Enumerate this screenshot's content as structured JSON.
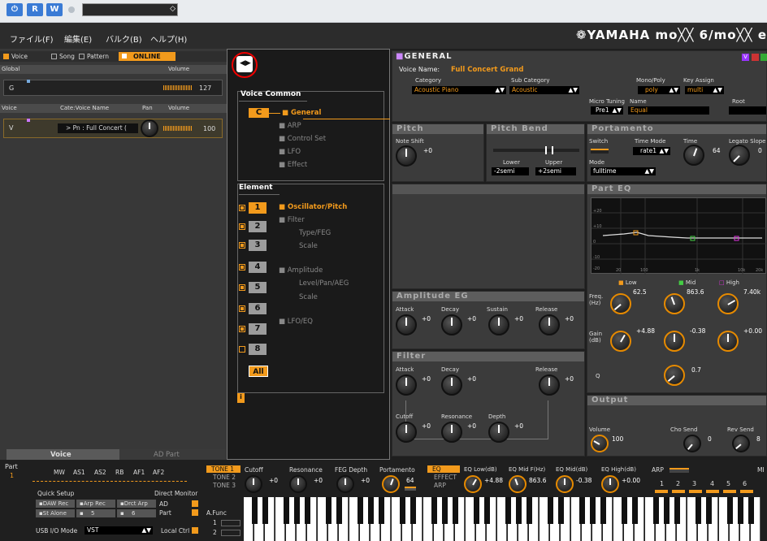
{
  "menubar": {
    "file": "ファイル(F)",
    "edit": "編集(E)",
    "bulk": "バルク(B)",
    "help": "ヘルプ(H)",
    "brand": "❁YAMAHA  mo╳╳ 6/mo╳╳ e"
  },
  "toolbar": {
    "r": "R",
    "w": "W"
  },
  "left": {
    "tabs": {
      "voice": "Voice",
      "song": "Song",
      "pattern": "Pattern",
      "online": "ONLINE"
    },
    "global_header": "Global",
    "volume_header": "Volume",
    "global_row": {
      "label": "G",
      "volume": "127"
    },
    "voice_headers": {
      "voice": "Voice",
      "cate": "Cate:Voice Name",
      "pan": "Pan",
      "volume": "Volume"
    },
    "voice_row": {
      "label": "V",
      "name": "> Pn : Full Concert (",
      "volume": "100"
    },
    "bottom_tabs": {
      "voice": "Voice",
      "ad": "AD Part"
    }
  },
  "nav": {
    "voice_common": "Voice Common",
    "c": "C",
    "general": "General",
    "arp": "ARP",
    "control_set": "Control Set",
    "lfo": "LFO",
    "effect": "Effect",
    "element": "Element",
    "osc": "Oscillator/Pitch",
    "filter": "Filter",
    "type_feg": "Type/FEG",
    "scale": "Scale",
    "amplitude": "Amplitude",
    "level_pan": "Level/Pan/AEG",
    "scale2": "Scale",
    "lfo_eq": "LFO/EQ",
    "elements": [
      "1",
      "2",
      "3",
      "4",
      "5",
      "6",
      "7",
      "8"
    ],
    "all": "All",
    "info": "i"
  },
  "general": {
    "title": "GENERAL",
    "voice_name_label": "Voice Name:",
    "voice_name": "Full Concert Grand",
    "category_label": "Category",
    "category": "Acoustic Piano",
    "sub_category_label": "Sub Category",
    "sub_category": "Acoustic",
    "mono_poly_label": "Mono/Poly",
    "mono_poly": "poly",
    "key_assign_label": "Key Assign",
    "key_assign": "multi",
    "micro_tuning_label": "Micro Tuning",
    "name_label": "Name",
    "micro_tuning": "Pre1",
    "tuning_name": "Equal",
    "root_label": "Root",
    "badges": "V"
  },
  "pitch": {
    "title": "Pitch",
    "note_shift_label": "Note Shift",
    "note_shift": "+0"
  },
  "pitch_bend": {
    "title": "Pitch Bend",
    "lower_label": "Lower",
    "upper_label": "Upper",
    "lower": "-2semi",
    "upper": "+2semi"
  },
  "portamento": {
    "title": "Portamento",
    "switch_label": "Switch",
    "time_mode_label": "Time Mode",
    "time_mode": "rate1",
    "time_label": "Time",
    "time": "64",
    "legato_label": "Legato Slope",
    "legato": "0",
    "mode_label": "Mode",
    "mode": "fulltime"
  },
  "part_eq": {
    "title": "Part EQ",
    "y_ticks": [
      "+20",
      "+10",
      "0",
      "-10",
      "-20"
    ],
    "x_ticks": [
      "20",
      "100",
      "1k",
      "10k",
      "20k"
    ],
    "bands": {
      "low": "Low",
      "mid": "Mid",
      "high": "High"
    },
    "freq_label": "Freq.\n(Hz)",
    "freq": [
      "62.5",
      "863.6",
      "7.40k"
    ],
    "gain_label": "Gain\n(dB)",
    "gain": [
      "+4.88",
      "-0.38",
      "+0.00"
    ],
    "q_label": "Q",
    "q": "0.7"
  },
  "amp_eg": {
    "title": "Amplitude EG",
    "labels": [
      "Attack",
      "Decay",
      "Sustain",
      "Release"
    ],
    "values": [
      "+0",
      "+0",
      "+0",
      "+0"
    ]
  },
  "filter": {
    "title": "Filter",
    "labels": [
      "Attack",
      "Decay",
      "Release"
    ],
    "values": [
      "+0",
      "+0",
      "+0"
    ],
    "labels2": [
      "Cutoff",
      "Resonance",
      "Depth"
    ],
    "values2": [
      "+0",
      "+0",
      "+0"
    ]
  },
  "output": {
    "title": "Output",
    "volume_label": "Volume",
    "volume": "100",
    "cho_label": "Cho Send",
    "cho": "0",
    "rev_label": "Rev Send",
    "rev": "8"
  },
  "bottom": {
    "part_label": "Part",
    "part": "1",
    "mods": [
      "MW",
      "AS1",
      "AS2",
      "RB",
      "AF1",
      "AF2"
    ],
    "quick_setup": "Quick Setup",
    "direct_monitor": "Direct Monitor",
    "qs_buttons": [
      "DAW Rec",
      "Arp Rec",
      "Drct Arp"
    ],
    "st_alone": "St Alone",
    "qs5": "5",
    "qs6": "6",
    "ad": "AD",
    "part_txt": "Part",
    "usb_label": "USB I/O Mode",
    "usb": "VST",
    "local_ctrl": "Local Ctrl",
    "tones": [
      "TONE 1",
      "TONE 2",
      "TONE 3"
    ],
    "knobs": [
      {
        "label": "Cutoff",
        "value": "+0"
      },
      {
        "label": "Resonance",
        "value": "+0"
      },
      {
        "label": "FEG Depth",
        "value": "+0"
      },
      {
        "label": "Portamento",
        "value": "64"
      }
    ],
    "eq_effect_arp": [
      "EQ",
      "EFFECT",
      "ARP"
    ],
    "eq_knobs": [
      {
        "label": "EQ Low(dB)",
        "value": "+4.88"
      },
      {
        "label": "EQ Mid F(Hz)",
        "value": "863.6"
      },
      {
        "label": "EQ Mid(dB)",
        "value": "-0.38"
      },
      {
        "label": "EQ High(dB)",
        "value": "+0.00"
      }
    ],
    "arp": "ARP",
    "arp_nums": [
      "1",
      "2",
      "3",
      "4",
      "5",
      "6"
    ],
    "a_func": "A.Func",
    "a1": "1",
    "a2": "2",
    "mi": "MI"
  }
}
